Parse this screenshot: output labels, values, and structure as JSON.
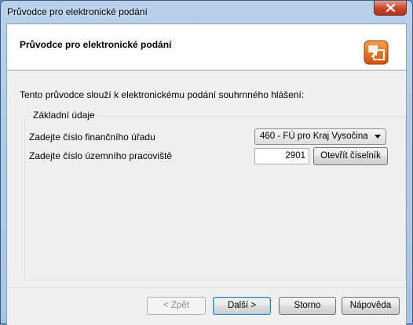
{
  "window": {
    "title": "Průvodce pro elektronické podání"
  },
  "header": {
    "title": "Průvodce pro elektronické podání",
    "icon": "wizard-logo-icon"
  },
  "description": "Tento průvodce slouží k elektronickému podání souhrnného hlášení:",
  "group": {
    "title": "Základní údaje",
    "fields": [
      {
        "label": "Zadejte číslo finančního úřadu",
        "value": "460 - FÚ pro Kraj Vysočina"
      },
      {
        "label": "Zadejte číslo územního pracoviště",
        "value": "2901"
      }
    ],
    "open_dial_label": "Otevřít číselník"
  },
  "buttons": {
    "back": "< Zpět",
    "next": "Další >",
    "cancel": "Storno",
    "help": "Nápověda"
  },
  "colors": {
    "accent": "#3c7fb1",
    "close": "#c9442c",
    "logo": "#e86a12"
  }
}
